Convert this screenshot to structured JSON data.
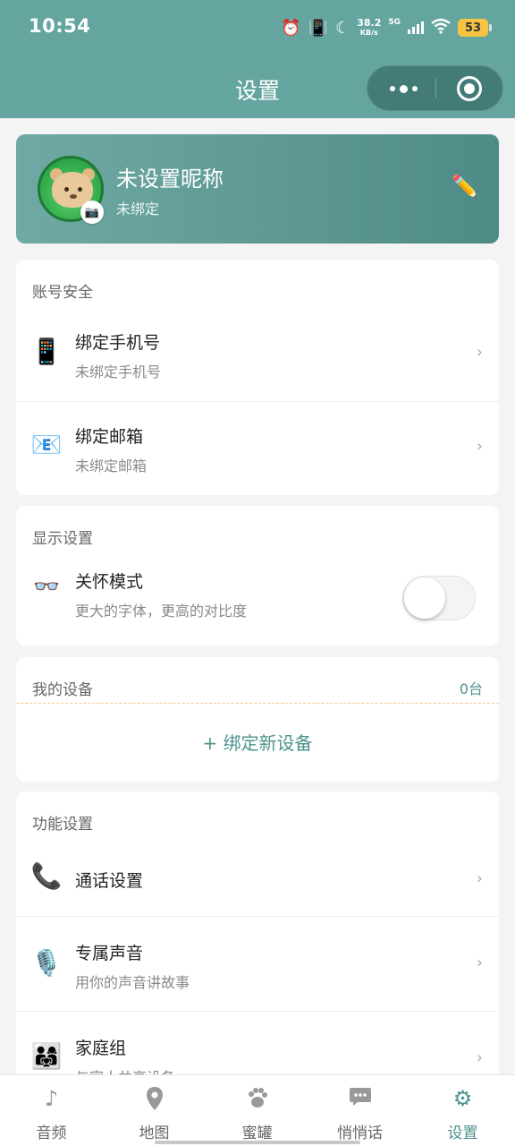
{
  "status_bar": {
    "time": "10:54",
    "net_speed": "38.2",
    "net_unit": "KB/s",
    "network": "5G",
    "battery": "53",
    "icons": [
      "alarm-icon",
      "vibrate-icon",
      "moon-icon",
      "signal-icon",
      "wifi-icon",
      "battery-icon"
    ]
  },
  "header": {
    "title": "设置",
    "capsule": {
      "more_icon": "more-dots-icon",
      "close_icon": "target-icon"
    }
  },
  "profile": {
    "nickname": "未设置昵称",
    "bind_status": "未绑定",
    "avatar_icon": "bear-avatar-icon",
    "camera_icon": "camera-icon",
    "edit_icon": "pencil-icon"
  },
  "account_security": {
    "title": "账号安全",
    "items": [
      {
        "label": "绑定手机号",
        "sub": "未绑定手机号",
        "icon": "phone-icon",
        "chevron": "›"
      },
      {
        "label": "绑定邮箱",
        "sub": "未绑定邮箱",
        "icon": "email-icon",
        "chevron": "›"
      }
    ]
  },
  "display_settings": {
    "title": "显示设置",
    "care_mode": {
      "label": "关怀模式",
      "sub": "更大的字体，更高的对比度",
      "icon": "glasses-icon",
      "enabled": false
    }
  },
  "my_devices": {
    "title": "我的设备",
    "count": "0台",
    "add_label": "绑定新设备",
    "add_icon": "+"
  },
  "function_settings": {
    "title": "功能设置",
    "items": [
      {
        "label": "通话设置",
        "sub": "",
        "icon": "telephone-icon",
        "chevron": "›"
      },
      {
        "label": "专属声音",
        "sub": "用你的声音讲故事",
        "icon": "microphone-icon",
        "chevron": "›"
      },
      {
        "label": "家庭组",
        "sub": "与家人共享设备",
        "icon": "family-icon",
        "chevron": "›"
      }
    ]
  },
  "tabbar": {
    "tabs": [
      {
        "label": "音频",
        "icon": "music-note-icon",
        "active": false
      },
      {
        "label": "地图",
        "icon": "map-pin-icon",
        "active": false
      },
      {
        "label": "蜜罐",
        "icon": "paw-icon",
        "active": false
      },
      {
        "label": "悄悄话",
        "icon": "chat-bubble-icon",
        "active": false
      },
      {
        "label": "设置",
        "icon": "gear-icon",
        "active": true
      }
    ]
  },
  "colors": {
    "brand": "#64a69f",
    "accent": "#4d938c",
    "battery": "#f6c343"
  }
}
